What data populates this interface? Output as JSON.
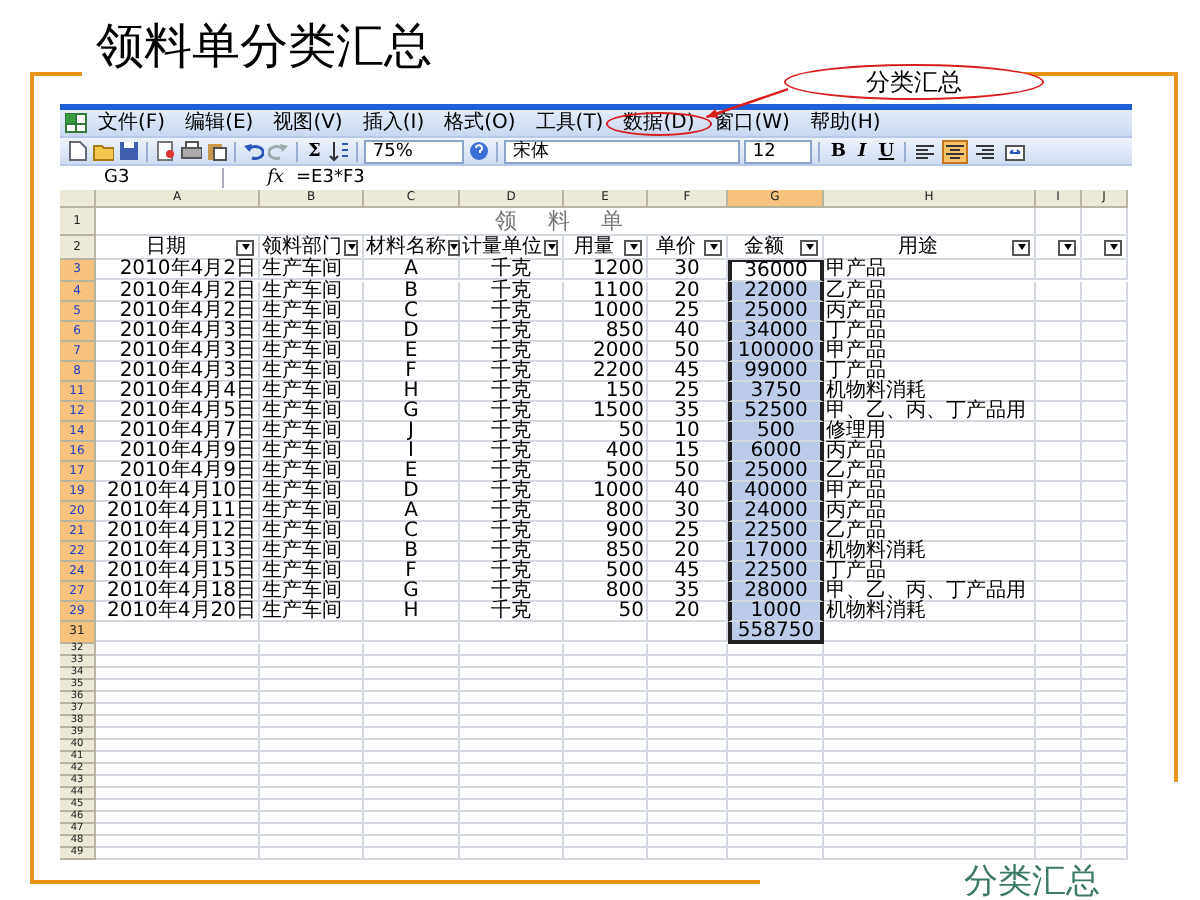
{
  "slide": {
    "title": "领料单分类汇总",
    "callout": "分类汇总",
    "footer": "分类汇总"
  },
  "window": {
    "menu": [
      {
        "label": "文件(F)",
        "circled": false
      },
      {
        "label": "编辑(E)",
        "circled": false
      },
      {
        "label": "视图(V)",
        "circled": false
      },
      {
        "label": "插入(I)",
        "circled": false
      },
      {
        "label": "格式(O)",
        "circled": false
      },
      {
        "label": "工具(T)",
        "circled": false
      },
      {
        "label": "数据(D)",
        "circled": true
      },
      {
        "label": "窗口(W)",
        "circled": false
      },
      {
        "label": "帮助(H)",
        "circled": false
      }
    ],
    "toolbar": {
      "sum": "Σ",
      "zoom": "75%",
      "font": "宋体",
      "font_size": "12",
      "format_buttons": [
        "B",
        "I",
        "U"
      ],
      "align": [
        {
          "selected": false
        },
        {
          "selected": true
        },
        {
          "selected": false
        },
        {
          "selected": false
        }
      ]
    },
    "formula_bar": {
      "cell_ref": "G3",
      "function_label": "fx",
      "formula": "=E3*F3"
    }
  },
  "sheet": {
    "columns": [
      {
        "letter": "A",
        "selected": false
      },
      {
        "letter": "B",
        "selected": false
      },
      {
        "letter": "C",
        "selected": false
      },
      {
        "letter": "D",
        "selected": false
      },
      {
        "letter": "E",
        "selected": false
      },
      {
        "letter": "F",
        "selected": false
      },
      {
        "letter": "G",
        "selected": true
      },
      {
        "letter": "H",
        "selected": false
      },
      {
        "letter": "I",
        "selected": false
      },
      {
        "letter": "J",
        "selected": false
      }
    ],
    "title_row": {
      "num": "1",
      "title": "领 料 单"
    },
    "header_row": {
      "num": "2",
      "headers": [
        {
          "label": "日期",
          "filter": true
        },
        {
          "label": "领料部门",
          "filter": true
        },
        {
          "label": "材料名称",
          "filter": true
        },
        {
          "label": "计量单位",
          "filter": true
        },
        {
          "label": "用量",
          "filter": true
        },
        {
          "label": "单价",
          "filter": true
        },
        {
          "label": "金额",
          "filter": true
        },
        {
          "label": "用途",
          "filter": true
        },
        {
          "filter": true
        },
        {
          "filter": true
        }
      ]
    },
    "rows": [
      {
        "num": "3",
        "selected": true,
        "filtered": true,
        "active": true,
        "cells": {
          "A": "2010年4月2日",
          "B": "生产车间",
          "C": "A",
          "D": "千克",
          "E": "1200",
          "F": "30",
          "G": "36000",
          "H": "甲产品"
        }
      },
      {
        "num": "4",
        "selected": true,
        "filtered": true,
        "active": false,
        "cells": {
          "A": "2010年4月2日",
          "B": "生产车间",
          "C": "B",
          "D": "千克",
          "E": "1100",
          "F": "20",
          "G": "22000",
          "H": "乙产品"
        }
      },
      {
        "num": "5",
        "selected": true,
        "filtered": true,
        "active": false,
        "cells": {
          "A": "2010年4月2日",
          "B": "生产车间",
          "C": "C",
          "D": "千克",
          "E": "1000",
          "F": "25",
          "G": "25000",
          "H": "丙产品"
        }
      },
      {
        "num": "6",
        "selected": true,
        "filtered": true,
        "active": false,
        "cells": {
          "A": "2010年4月3日",
          "B": "生产车间",
          "C": "D",
          "D": "千克",
          "E": "850",
          "F": "40",
          "G": "34000",
          "H": "丁产品"
        }
      },
      {
        "num": "7",
        "selected": true,
        "filtered": true,
        "active": false,
        "cells": {
          "A": "2010年4月3日",
          "B": "生产车间",
          "C": "E",
          "D": "千克",
          "E": "2000",
          "F": "50",
          "G": "100000",
          "H": "甲产品"
        }
      },
      {
        "num": "8",
        "selected": true,
        "filtered": true,
        "active": false,
        "cells": {
          "A": "2010年4月3日",
          "B": "生产车间",
          "C": "F",
          "D": "千克",
          "E": "2200",
          "F": "45",
          "G": "99000",
          "H": "丁产品"
        }
      },
      {
        "num": "11",
        "selected": true,
        "filtered": true,
        "active": false,
        "cells": {
          "A": "2010年4月4日",
          "B": "生产车间",
          "C": "H",
          "D": "千克",
          "E": "150",
          "F": "25",
          "G": "3750",
          "H": "机物料消耗"
        }
      },
      {
        "num": "12",
        "selected": true,
        "filtered": true,
        "active": false,
        "cells": {
          "A": "2010年4月5日",
          "B": "生产车间",
          "C": "G",
          "D": "千克",
          "E": "1500",
          "F": "35",
          "G": "52500",
          "H": "甲、乙、丙、丁产品用"
        }
      },
      {
        "num": "14",
        "selected": true,
        "filtered": true,
        "active": false,
        "cells": {
          "A": "2010年4月7日",
          "B": "生产车间",
          "C": "J",
          "D": "千克",
          "E": "50",
          "F": "10",
          "G": "500",
          "H": "修理用"
        }
      },
      {
        "num": "16",
        "selected": true,
        "filtered": true,
        "active": false,
        "cells": {
          "A": "2010年4月9日",
          "B": "生产车间",
          "C": "I",
          "D": "千克",
          "E": "400",
          "F": "15",
          "G": "6000",
          "H": "丙产品"
        }
      },
      {
        "num": "17",
        "selected": true,
        "filtered": true,
        "active": false,
        "cells": {
          "A": "2010年4月9日",
          "B": "生产车间",
          "C": "E",
          "D": "千克",
          "E": "500",
          "F": "50",
          "G": "25000",
          "H": "乙产品"
        }
      },
      {
        "num": "19",
        "selected": true,
        "filtered": true,
        "active": false,
        "cells": {
          "A": "2010年4月10日",
          "B": "生产车间",
          "C": "D",
          "D": "千克",
          "E": "1000",
          "F": "40",
          "G": "40000",
          "H": "甲产品"
        }
      },
      {
        "num": "20",
        "selected": true,
        "filtered": true,
        "active": false,
        "cells": {
          "A": "2010年4月11日",
          "B": "生产车间",
          "C": "A",
          "D": "千克",
          "E": "800",
          "F": "30",
          "G": "24000",
          "H": "丙产品"
        }
      },
      {
        "num": "21",
        "selected": true,
        "filtered": true,
        "active": false,
        "cells": {
          "A": "2010年4月12日",
          "B": "生产车间",
          "C": "C",
          "D": "千克",
          "E": "900",
          "F": "25",
          "G": "22500",
          "H": "乙产品"
        }
      },
      {
        "num": "22",
        "selected": true,
        "filtered": true,
        "active": false,
        "cells": {
          "A": "2010年4月13日",
          "B": "生产车间",
          "C": "B",
          "D": "千克",
          "E": "850",
          "F": "20",
          "G": "17000",
          "H": "机物料消耗"
        }
      },
      {
        "num": "24",
        "selected": true,
        "filtered": true,
        "active": false,
        "cells": {
          "A": "2010年4月15日",
          "B": "生产车间",
          "C": "F",
          "D": "千克",
          "E": "500",
          "F": "45",
          "G": "22500",
          "H": "丁产品"
        }
      },
      {
        "num": "27",
        "selected": true,
        "filtered": true,
        "active": false,
        "cells": {
          "A": "2010年4月18日",
          "B": "生产车间",
          "C": "G",
          "D": "千克",
          "E": "800",
          "F": "35",
          "G": "28000",
          "H": "甲、乙、丙、丁产品用"
        }
      },
      {
        "num": "29",
        "selected": true,
        "filtered": true,
        "active": false,
        "cells": {
          "A": "2010年4月20日",
          "B": "生产车间",
          "C": "H",
          "D": "千克",
          "E": "50",
          "F": "20",
          "G": "1000",
          "H": "机物料消耗"
        }
      },
      {
        "num": "31",
        "selected": true,
        "filtered": false,
        "active": false,
        "cells": {
          "G": "558750"
        }
      }
    ],
    "empty_rows": [
      "32",
      "33",
      "34",
      "35",
      "36",
      "37",
      "38",
      "39",
      "40",
      "41",
      "42",
      "43",
      "44",
      "45",
      "46",
      "47",
      "48",
      "49"
    ]
  }
}
